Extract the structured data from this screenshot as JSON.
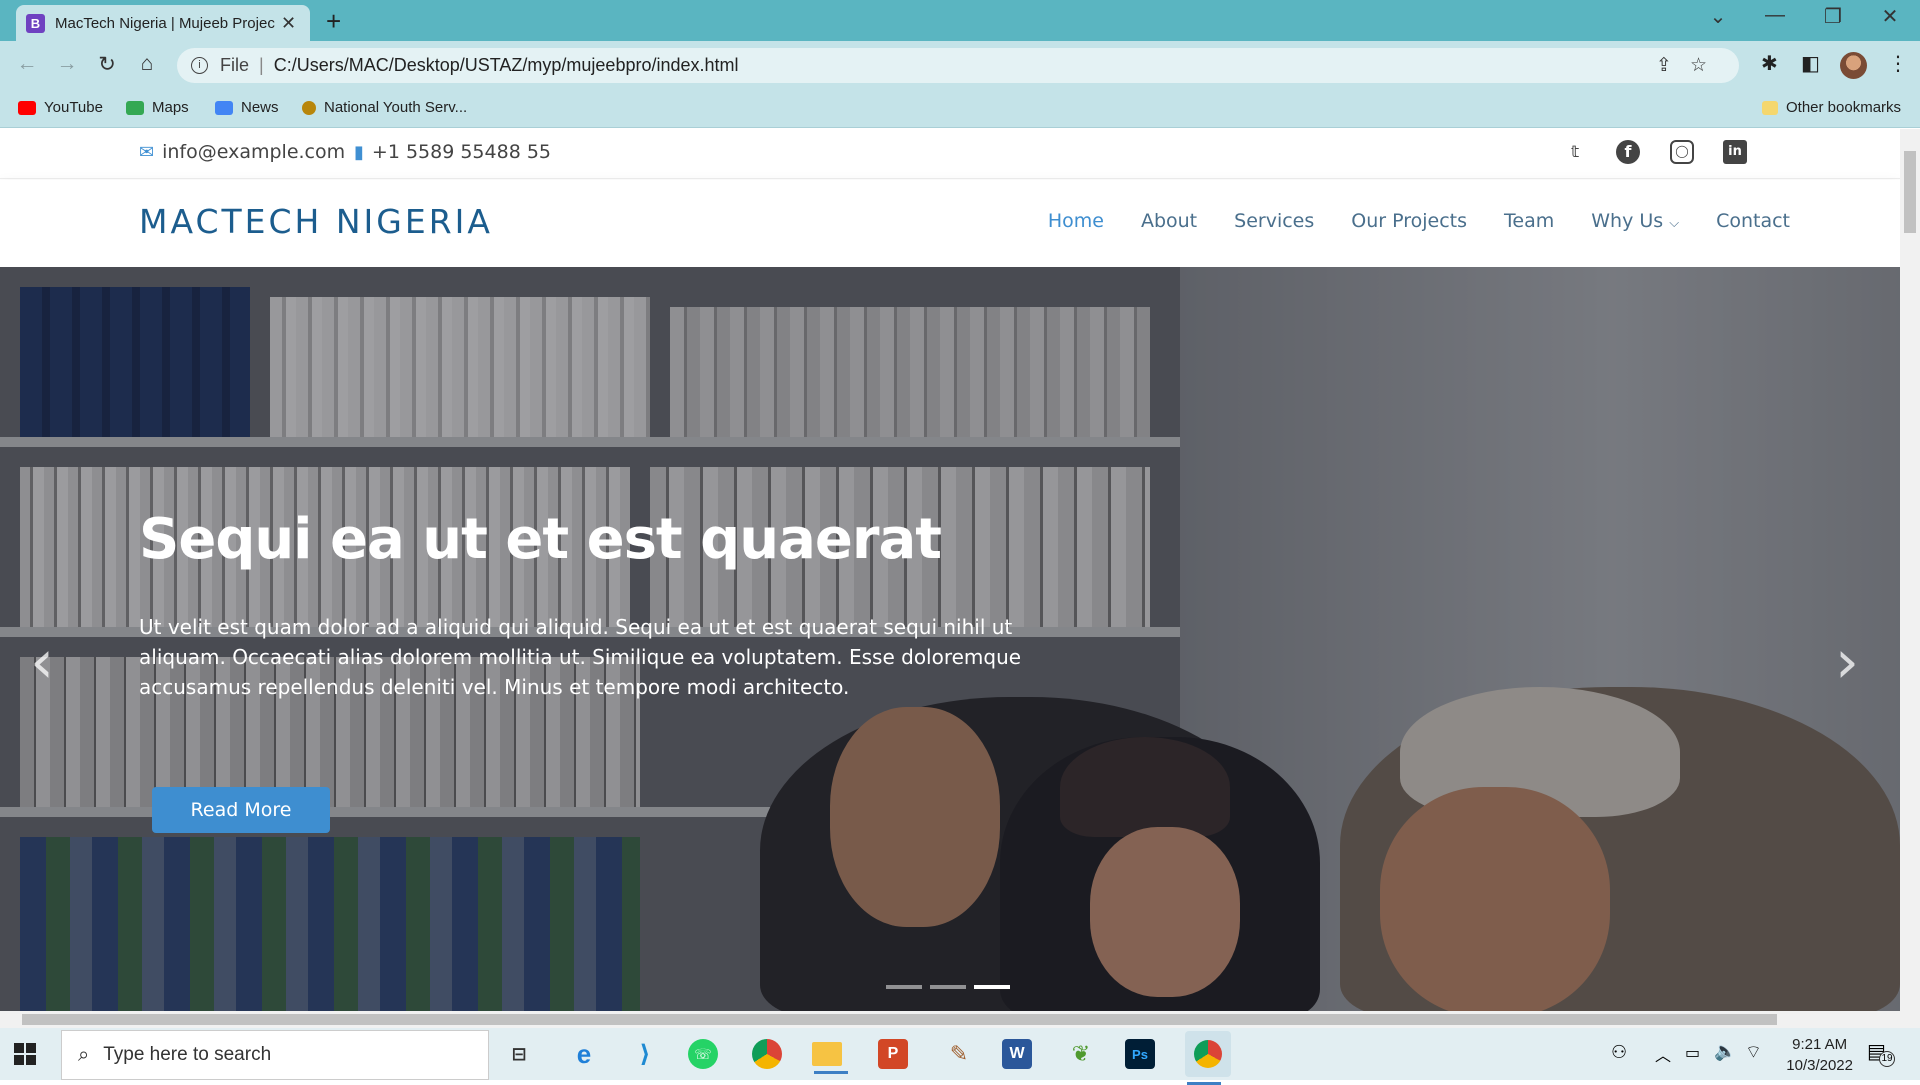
{
  "browser": {
    "tab_title": "MacTech Nigeria | Mujeeb Projec",
    "url_scheme": "File",
    "url": "C:/Users/MAC/Desktop/USTAZ/myp/mujeebpro/index.html",
    "bookmarks": [
      {
        "label": "YouTube",
        "color": "#ff0000"
      },
      {
        "label": "Maps",
        "color": "#34a853"
      },
      {
        "label": "News",
        "color": "#4285f4"
      },
      {
        "label": "National Youth Serv...",
        "color": "#b8860b"
      }
    ],
    "other_bookmarks": "Other bookmarks"
  },
  "site": {
    "email": "info@example.com",
    "phone": "+1 5589 55488 55",
    "logo": "MACTECH NIGERIA",
    "nav": [
      "Home",
      "About",
      "Services",
      "Our Projects",
      "Team",
      "Why Us",
      "Contact"
    ],
    "social_icons": [
      "twitter-icon",
      "facebook-icon",
      "instagram-icon",
      "linkedin-icon"
    ],
    "hero": {
      "title": "Sequi ea ut et est quaerat",
      "text": "Ut velit est quam dolor ad a aliquid qui aliquid. Sequi ea ut et est quaerat sequi nihil ut aliquam. Occaecati alias dolorem mollitia ut. Similique ea voluptatem. Esse doloremque accusamus repellendus deleniti vel. Minus et tempore modi architecto.",
      "button": "Read More",
      "active_slide": 3,
      "slide_count": 3
    },
    "accent_color": "#3e8ed0"
  },
  "taskbar": {
    "search_placeholder": "Type here to search",
    "apps": [
      "task-view-icon",
      "edge-icon",
      "vscode-icon",
      "whatsapp-icon",
      "chrome-icon",
      "file-explorer-icon",
      "powerpoint-icon",
      "paint-icon",
      "word-icon",
      "app-icon",
      "photoshop-icon",
      "chrome-active-icon"
    ],
    "time": "9:21 AM",
    "date": "10/3/2022",
    "notifications": "19"
  }
}
